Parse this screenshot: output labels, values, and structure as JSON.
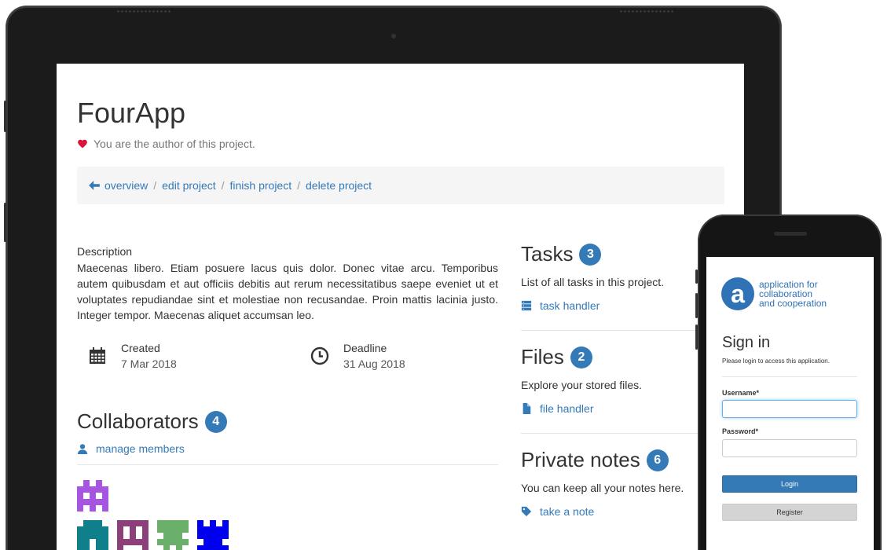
{
  "tablet": {
    "app_title": "FourApp",
    "author_note": "You are the author of this project.",
    "breadcrumb": {
      "overview": "overview",
      "edit": "edit project",
      "finish": "finish project",
      "delete": "delete project",
      "separator": "/"
    },
    "description": {
      "label": "Description",
      "text": "Maecenas libero. Etiam posuere lacus quis dolor. Donec vitae arcu. Temporibus autem quibusdam et aut officiis debitis aut rerum necessitatibus saepe eveniet ut et voluptates repudiandae sint et molestiae non recusandae. Proin mattis lacinia justo. Integer tempor. Maecenas aliquet accumsan leo."
    },
    "created": {
      "label": "Created",
      "value": "7 Mar 2018",
      "icon": "calendar-icon"
    },
    "deadline": {
      "label": "Deadline",
      "value": "31 Aug 2018",
      "icon": "clock-icon"
    },
    "collaborators": {
      "title": "Collaborators",
      "count": "4",
      "manage_link": "manage members"
    },
    "tasks": {
      "title": "Tasks",
      "count": "3",
      "desc": "List of all tasks in this project.",
      "link": "task handler"
    },
    "files": {
      "title": "Files",
      "count": "2",
      "desc": "Explore your stored files.",
      "link": "file handler"
    },
    "notes": {
      "title": "Private notes",
      "count": "6",
      "desc": "You can keep all your notes here.",
      "link": "take a note"
    },
    "avatar_colors": [
      "#a555e0",
      "#0f7f8c",
      "#8c3f78",
      "#6bb06a",
      "#0000ee"
    ]
  },
  "phone": {
    "brand_letter": "a",
    "brand_line1": "application for",
    "brand_line2": "collaboration",
    "brand_line3": "and cooperation",
    "signin_title": "Sign in",
    "signin_subtitle": "Please login to access this application.",
    "username_label": "Username*",
    "username_value": "",
    "password_label": "Password*",
    "password_value": "",
    "login_button": "Login",
    "register_button": "Register"
  },
  "colors": {
    "accent": "#337ab7",
    "heart": "#d9143d",
    "device": "#1b1b1b"
  }
}
